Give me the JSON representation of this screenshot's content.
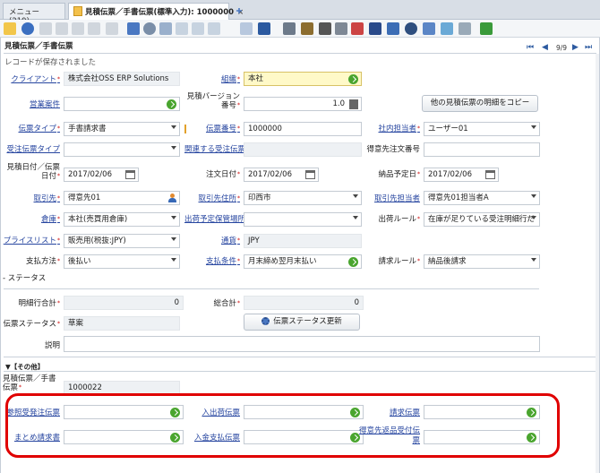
{
  "tabs": {
    "menu_label": "メニュー (219)",
    "active_label": "見積伝票／手書伝票(標準入力): 1000000",
    "close": "×"
  },
  "window": {
    "title": "見積伝票／手書伝票",
    "record_counter": "9/9",
    "status_message": "レコードが保存されました"
  },
  "fields": {
    "client": {
      "label": "クライアント",
      "value": "株式会社OSS ERP Solutions"
    },
    "organization": {
      "label": "組織",
      "value": "本社"
    },
    "sales_project": {
      "label": "営業案件",
      "value": ""
    },
    "quote_version": {
      "label": "見積バージョン番号",
      "value": "1.0"
    },
    "copy_button": {
      "label": "他の見積伝票の明細をコピー"
    },
    "doc_type": {
      "label": "伝票タイプ",
      "value": "手書請求書"
    },
    "doc_no": {
      "label": "伝票番号",
      "value": "1000000"
    },
    "sales_rep": {
      "label": "社内担当者",
      "value": "ユーザー01"
    },
    "order_doc_type": {
      "label": "受注伝票タイプ",
      "value": ""
    },
    "related_order": {
      "label": "関連する受注伝票",
      "value": ""
    },
    "customer_order_no": {
      "label": "得意先注文番号",
      "value": ""
    },
    "quote_date": {
      "label": "見積日付／伝票日付",
      "value": "2017/02/06"
    },
    "order_date": {
      "label": "注文日付",
      "value": "2017/02/06"
    },
    "delivery_date": {
      "label": "納品予定日",
      "value": "2017/02/06"
    },
    "partner": {
      "label": "取引先",
      "value": "得意先01"
    },
    "partner_address": {
      "label": "取引先住所",
      "value": "印西市"
    },
    "partner_contact": {
      "label": "取引先担当者",
      "value": "得意先01担当者A"
    },
    "warehouse": {
      "label": "倉庫",
      "value": "本社(売買用倉庫)"
    },
    "ship_loc": {
      "label": "出荷予定保管場所",
      "value": ""
    },
    "ship_rule": {
      "label": "出荷ルール",
      "value": "在庫が足りている受注明細行だ"
    },
    "price_list": {
      "label": "プライスリスト",
      "value": "販売用(税抜:JPY)"
    },
    "currency": {
      "label": "通貨",
      "value": "JPY"
    },
    "pay_method": {
      "label": "支払方法",
      "value": "後払い"
    },
    "pay_terms": {
      "label": "支払条件",
      "value": "月末締め翌月末払い"
    },
    "invoice_rule": {
      "label": "請求ルール",
      "value": "納品後請求"
    }
  },
  "status_section": {
    "header": "- ステータス",
    "line_total": {
      "label": "明細行合計",
      "value": "0"
    },
    "grand_total": {
      "label": "総合計",
      "value": "0"
    },
    "doc_status": {
      "label": "伝票ステータス",
      "value": "草案"
    },
    "update_button": "伝票ステータス更新",
    "description": {
      "label": "説明",
      "value": ""
    }
  },
  "other_section": {
    "header": "▼【その他】",
    "quote_invoice_id": {
      "label": "見積伝票／手書伝票",
      "value": "1000022"
    },
    "ref_po": {
      "label": "参照受発注伝票",
      "value": ""
    },
    "inout_doc": {
      "label": "入出荷伝票",
      "value": ""
    },
    "invoice_doc": {
      "label": "請求伝票",
      "value": ""
    },
    "bulk_invoice": {
      "label": "まとめ請求書",
      "value": ""
    },
    "payment_doc": {
      "label": "入金支払伝票",
      "value": ""
    },
    "customer_return": {
      "label": "得意先返品受付伝票",
      "value": ""
    }
  },
  "colors": {
    "accent_red": "#e00000",
    "link": "#2746a0",
    "go_green": "#4aa52f"
  }
}
